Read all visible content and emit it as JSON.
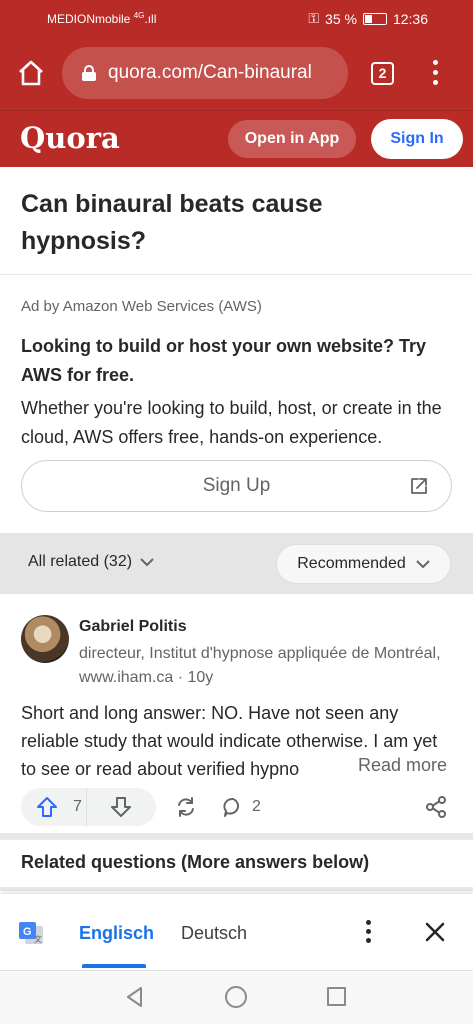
{
  "status": {
    "carrier": "MEDIONmobile",
    "signal": "4G",
    "battery": "35 %",
    "time": "12:36"
  },
  "browser": {
    "url": "quora.com/Can-binaural",
    "tab_count": "2"
  },
  "header": {
    "logo": "Quora",
    "open_in_app": "Open in App",
    "sign_in": "Sign In"
  },
  "question": {
    "title": "Can binaural beats cause hypnosis?"
  },
  "ad": {
    "label": "Ad by Amazon Web Services (AWS)",
    "headline": "Looking to build or host your own website? Try AWS for free.",
    "body": "Whether you're looking to build, host, or create in the cloud, AWS offers free, hands-on experience.",
    "button": "Sign Up"
  },
  "filters": {
    "all_related": "All related (32)",
    "sort": "Recommended"
  },
  "answer": {
    "author": "Gabriel Politis",
    "credential": "directeur, Institut d'hypnose appliquée de Montréal, www.iham.ca · 10y",
    "text": "Short and long answer: NO. Have not seen any reliable study that would indicate otherwise. I am yet to see or read about verified hypno",
    "read_more": "Read more",
    "upvotes": "7",
    "comments": "2"
  },
  "related_questions": {
    "title": "Related questions (More answers below)"
  },
  "translate": {
    "active_lang": "Englisch",
    "other_lang": "Deutsch"
  },
  "icons": [
    "home-icon",
    "lock-icon",
    "tabs-icon",
    "menu-icon",
    "external-link-icon",
    "chevron-down-icon",
    "upvote-icon",
    "downvote-icon",
    "share-icon",
    "comment-icon",
    "more-share-icon",
    "google-translate-icon",
    "close-icon",
    "back-icon",
    "nav-home-icon",
    "recents-icon"
  ],
  "colors": {
    "brand": "#b92b27",
    "link_blue": "#2e69ff",
    "translate_blue": "#1a73e8"
  }
}
